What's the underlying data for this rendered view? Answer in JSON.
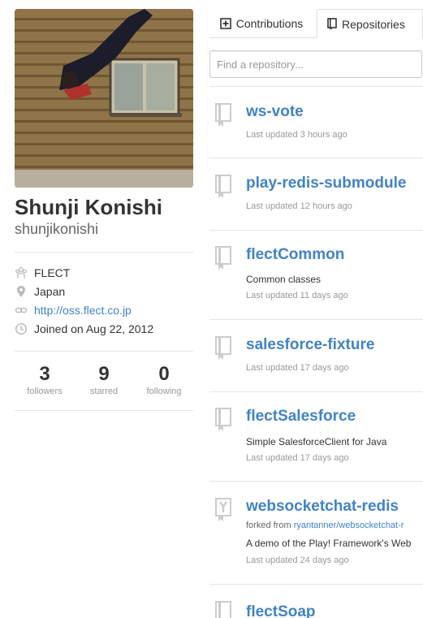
{
  "profile": {
    "fullname": "Shunji Konishi",
    "username": "shunjikonishi",
    "organization": "FLECT",
    "location": "Japan",
    "website": "http://oss.flect.co.jp",
    "joined": "Joined on Aug 22, 2012",
    "stats": [
      {
        "count": "3",
        "label": "followers"
      },
      {
        "count": "9",
        "label": "starred"
      },
      {
        "count": "0",
        "label": "following"
      }
    ]
  },
  "tabs": {
    "contributions": "Contributions",
    "repositories": "Repositories",
    "selected": "Repositories"
  },
  "search": {
    "placeholder": "Find a repository..."
  },
  "repos": [
    {
      "name": "ws-vote",
      "updated": "Last updated 3 hours ago"
    },
    {
      "name": "play-redis-submodule",
      "updated": "Last updated 12 hours ago"
    },
    {
      "name": "flectCommon",
      "description": "Common classes",
      "updated": "Last updated 11 days ago"
    },
    {
      "name": "salesforce-fixture",
      "updated": "Last updated 17 days ago"
    },
    {
      "name": "flectSalesforce",
      "description": "Simple SalesforceClient for Java",
      "updated": "Last updated 17 days ago"
    },
    {
      "name": "websocketchat-redis",
      "forked_prefix": "forked from",
      "forked_from": "ryantanner/websocketchat-r",
      "description": "A demo of the Play! Framework's Web",
      "updated": "Last updated 24 days ago"
    },
    {
      "name": "flectSoap"
    }
  ],
  "icons": {
    "organization": "org-icon",
    "location": "location-pin-icon",
    "website": "link-icon",
    "joined": "clock-icon",
    "contributions": "plus-square-icon",
    "repositories": "book-icon",
    "repo": "repo-book-icon",
    "fork": "fork-icon"
  },
  "colors": {
    "link": "#4183c4",
    "muted": "#999999"
  }
}
